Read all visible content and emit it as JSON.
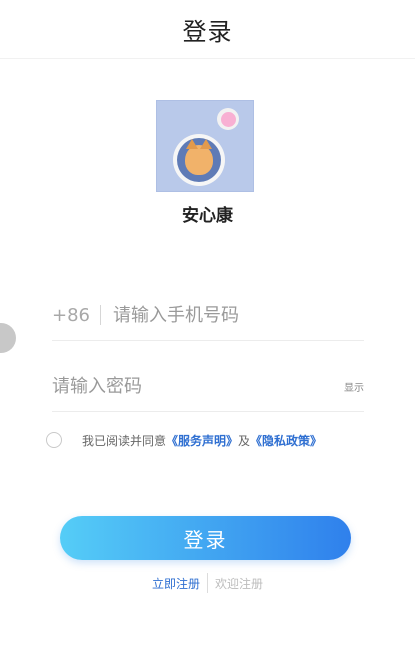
{
  "header": {
    "title": "登录"
  },
  "logo": {
    "app_name": "安心康"
  },
  "phone_field": {
    "prefix": "+86",
    "placeholder": "请输入手机号码",
    "value": ""
  },
  "password_field": {
    "placeholder": "请输入密码",
    "value": "",
    "show_label": "显示"
  },
  "agreement": {
    "prefix": "我已阅读并同意",
    "service_link": "《服务声明》",
    "connector": "及",
    "privacy_link": "《隐私政策》"
  },
  "login_button": {
    "label": "登录"
  },
  "bottom": {
    "register": "立即注册",
    "welcome": "欢迎注册"
  }
}
